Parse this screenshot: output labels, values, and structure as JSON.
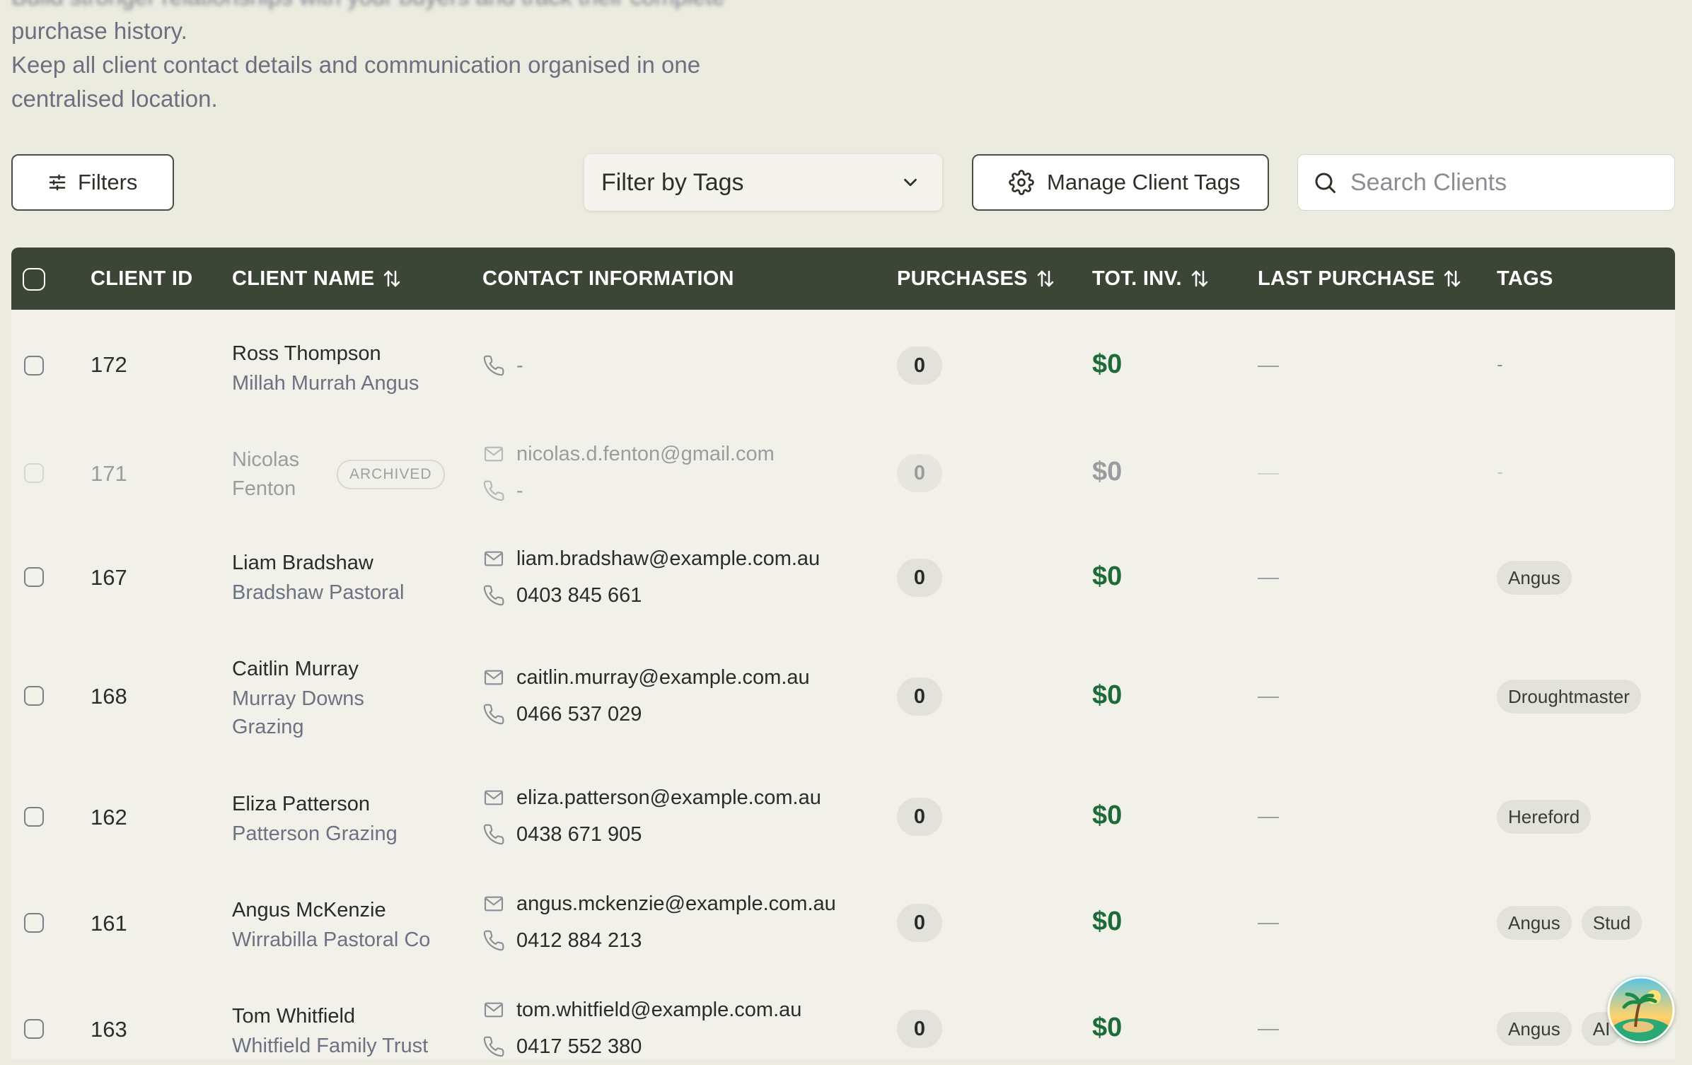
{
  "intro": {
    "blurred_line": "Build stronger relationships with your buyers and track their complete",
    "line1": "purchase history.",
    "line2": "Keep all client contact details and communication organised in one",
    "line3": "centralised location."
  },
  "toolbar": {
    "filters_label": "Filters",
    "tags_placeholder": "Filter by Tags",
    "manage_label": "Manage Client Tags",
    "search_placeholder": "Search Clients"
  },
  "table": {
    "headers": {
      "client_id": "CLIENT ID",
      "client_name": "CLIENT NAME",
      "contact": "CONTACT INFORMATION",
      "purchases": "PURCHASES",
      "tot_inv": "TOT. INV.",
      "last_purchase": "LAST PURCHASE",
      "tags": "TAGS"
    },
    "rows": [
      {
        "id": "172",
        "name": "Ross Thompson",
        "business": "Millah Murrah Angus",
        "email": "",
        "phone": "-",
        "purchases": "0",
        "total": "$0",
        "tags": []
      },
      {
        "id": "171",
        "name": "Nicolas",
        "business": "Fenton",
        "email": "nicolas.d.fenton@gmail.com",
        "phone": "-",
        "purchases": "0",
        "total": "$0",
        "badge": "ARCHIVED",
        "tags": []
      },
      {
        "id": "167",
        "name": "Liam Bradshaw",
        "business": "Bradshaw Pastoral",
        "email": "liam.bradshaw@example.com.au",
        "phone": "0403 845 661",
        "purchases": "0",
        "total": "$0",
        "tags": [
          "Angus"
        ]
      },
      {
        "id": "168",
        "name": "Caitlin Murray",
        "business": "Murray Downs",
        "business2": "Grazing",
        "email": "caitlin.murray@example.com.au",
        "phone": "0466 537 029",
        "purchases": "0",
        "total": "$0",
        "tags": [
          "Droughtmaster"
        ]
      },
      {
        "id": "162",
        "name": "Eliza Patterson",
        "business": "Patterson Grazing",
        "email": "eliza.patterson@example.com.au",
        "phone": "0438 671 905",
        "purchases": "0",
        "total": "$0",
        "tags": [
          "Hereford"
        ]
      },
      {
        "id": "161",
        "name": "Angus McKenzie",
        "business": "Wirrabilla Pastoral Co",
        "email": "angus.mckenzie@example.com.au",
        "phone": "0412 884 213",
        "purchases": "0",
        "total": "$0",
        "tags": [
          "Angus",
          "Stud"
        ]
      },
      {
        "id": "163",
        "name": "Tom Whitfield",
        "business": "Whitfield Family Trust",
        "email": "tom.whitfield@example.com.au",
        "phone": "0417 552 380",
        "purchases": "0",
        "total": "$0",
        "tags": [
          "Angus",
          "AI"
        ]
      }
    ],
    "empty_dash": "-"
  },
  "colors": {
    "header_bg": "#3c4636",
    "money": "#1e6b3a",
    "page_bg": "#ecebe0"
  }
}
